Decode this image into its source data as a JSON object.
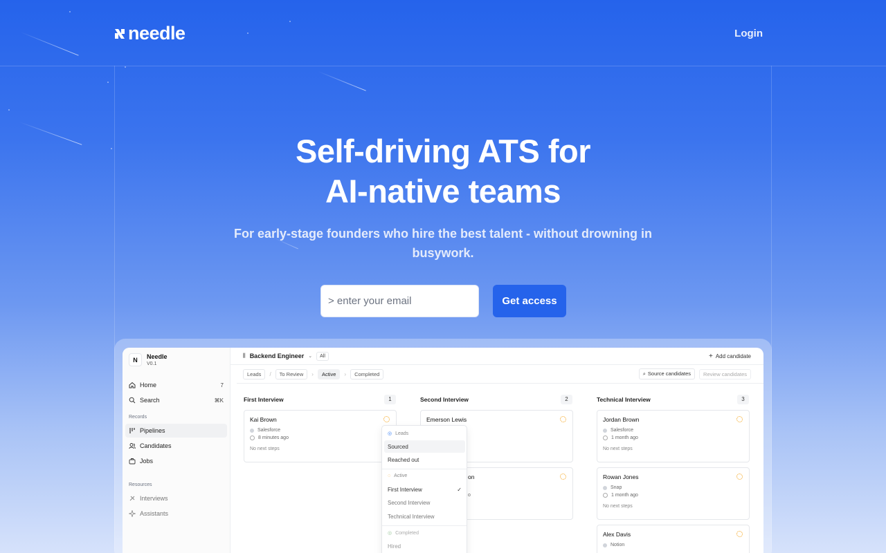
{
  "brand": {
    "name": "needle",
    "primary_color": "#2563eb"
  },
  "header": {
    "login_label": "Login"
  },
  "hero": {
    "title_line1": "Self-driving ATS for",
    "title_line2": "AI-native teams",
    "subtitle": "For early-stage founders who hire the best talent - without drowning in busywork.",
    "email_placeholder": "> enter your email",
    "cta_label": "Get access"
  },
  "app": {
    "workspace": {
      "name": "Needle",
      "version": "V0.1",
      "logo_letter": "N"
    },
    "sidebar": {
      "home": {
        "label": "Home",
        "count": "7"
      },
      "search": {
        "label": "Search",
        "shortcut": "⌘K"
      },
      "records_label": "Records",
      "records": [
        {
          "label": "Pipelines"
        },
        {
          "label": "Candidates"
        },
        {
          "label": "Jobs"
        }
      ],
      "resources_label": "Resources",
      "resources": [
        {
          "label": "Interviews"
        },
        {
          "label": "Assistants"
        }
      ]
    },
    "topbar": {
      "title": "Backend Engineer",
      "filter": "All",
      "add_label": "Add candidate"
    },
    "stages": {
      "leads": "Leads",
      "review": "To Review",
      "active": "Active",
      "completed": "Completed"
    },
    "actions": {
      "source": "Source candidates",
      "review": "Review candidates"
    },
    "columns": [
      {
        "title": "First Interview",
        "count": "1",
        "cards": [
          {
            "name": "Kai Brown",
            "source": "Salesforce",
            "time": "8 minutes ago",
            "next": "No next steps"
          }
        ]
      },
      {
        "title": "Second Interview",
        "count": "2",
        "cards": [
          {
            "name": "Emerson Lewis",
            "source": "",
            "time": "",
            "next": ""
          },
          {
            "name": "on",
            "source": "",
            "time": "o",
            "next": ""
          }
        ]
      },
      {
        "title": "Technical Interview",
        "count": "3",
        "cards": [
          {
            "name": "Jordan Brown",
            "source": "Salesforce",
            "time": "1 month ago",
            "next": "No next steps"
          },
          {
            "name": "Rowan Jones",
            "source": "Snap",
            "time": "1 month ago",
            "next": "No next steps"
          },
          {
            "name": "Alex Davis",
            "source": "Notion",
            "time": "",
            "next": ""
          }
        ]
      }
    ],
    "dropdown": {
      "group_leads": "Leads",
      "sourced": "Sourced",
      "reached_out": "Reached out",
      "group_active": "Active",
      "first_interview": "First Interview",
      "second_interview": "Second Interview",
      "technical_interview": "Technical Interview",
      "group_completed": "Completed",
      "hired": "Hired"
    }
  }
}
